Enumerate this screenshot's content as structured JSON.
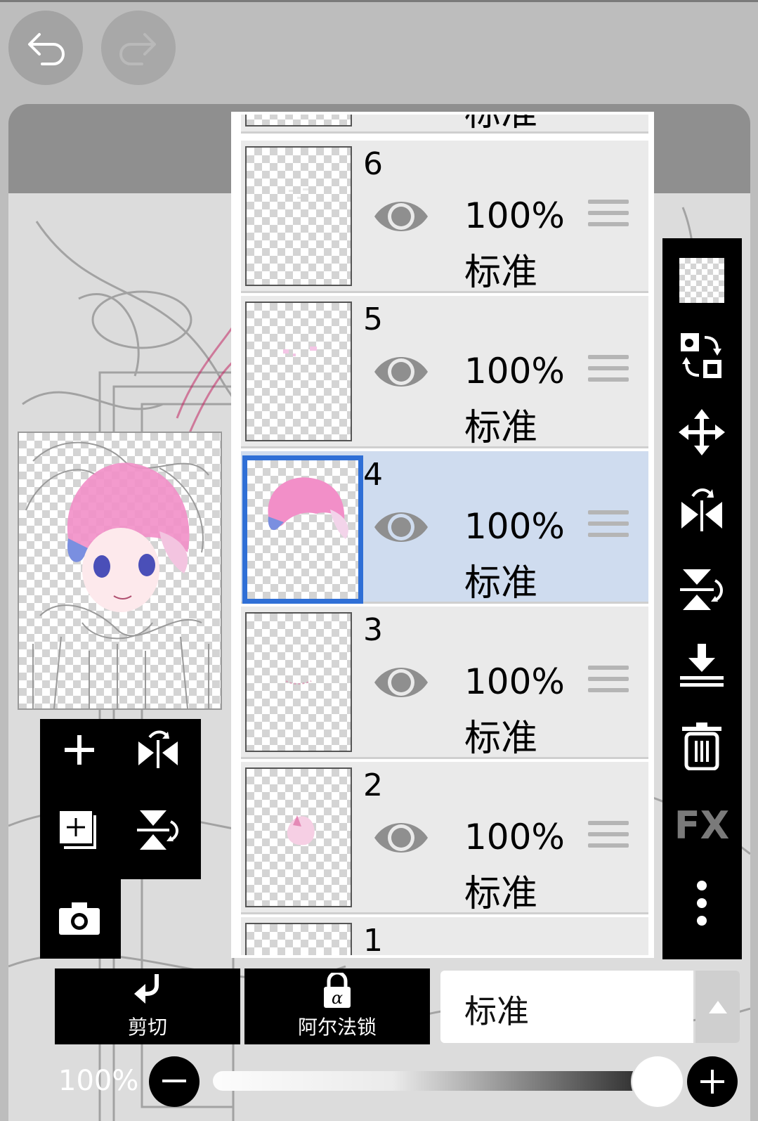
{
  "header": {
    "undo_icon": "undo-arrow-icon",
    "redo_icon": "redo-arrow-icon"
  },
  "layers": [
    {
      "number": "6",
      "opacity": "100%",
      "blend": "标准",
      "visible": true,
      "selected": false
    },
    {
      "number": "5",
      "opacity": "100%",
      "blend": "标准",
      "visible": true,
      "selected": false
    },
    {
      "number": "4",
      "opacity": "100%",
      "blend": "标准",
      "visible": true,
      "selected": true
    },
    {
      "number": "3",
      "opacity": "100%",
      "blend": "标准",
      "visible": true,
      "selected": false
    },
    {
      "number": "2",
      "opacity": "100%",
      "blend": "标准",
      "visible": true,
      "selected": false
    }
  ],
  "partial_layers": {
    "top_blend": "标准",
    "bottom_number": "1"
  },
  "right_toolbar": {
    "fx_label": "FX",
    "icons": [
      "transparency-icon",
      "swap-layer-icon",
      "move-icon",
      "flip-horizontal-icon",
      "flip-vertical-icon",
      "merge-down-icon",
      "trash-icon",
      "fx-icon",
      "more-icon"
    ]
  },
  "left_toolbar": {
    "icons": [
      "add-layer-icon",
      "flip-horizontal-icon",
      "duplicate-layer-icon",
      "flip-vertical-icon",
      "camera-icon"
    ]
  },
  "bottom": {
    "clip_label": "剪切",
    "alpha_lock_label": "阿尔法锁",
    "blend_mode": "标准",
    "opacity_label": "100%",
    "opacity_value": 1.0
  },
  "colors": {
    "accent": "#2f6fd6",
    "selected_layer_bg": "#cfdcef"
  }
}
